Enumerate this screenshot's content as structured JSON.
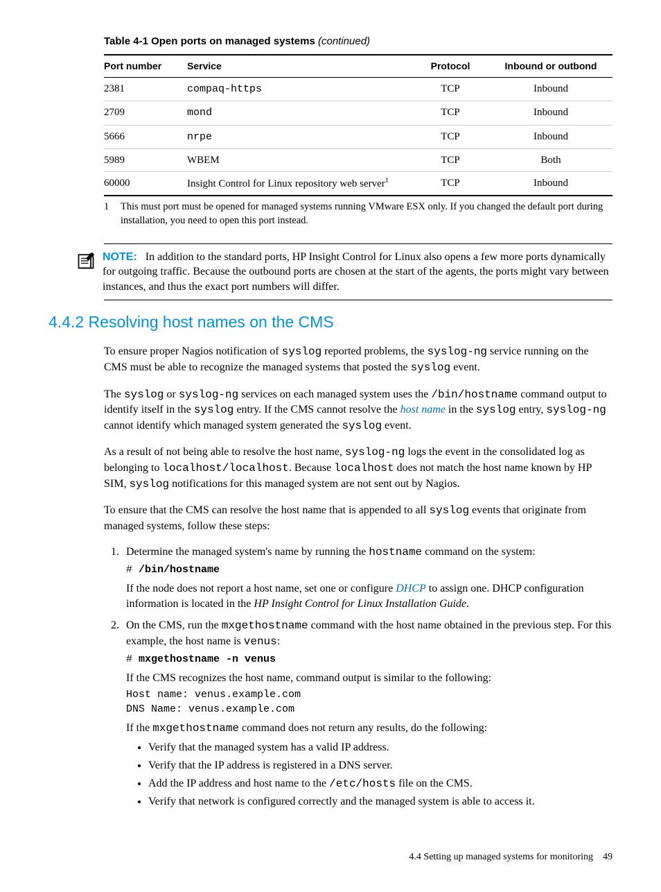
{
  "table": {
    "title_prefix": "Table 4-1 Open ports on managed systems ",
    "title_suffix": "(continued)",
    "headers": [
      "Port number",
      "Service",
      "Protocol",
      "Inbound or outbond"
    ],
    "rows": [
      {
        "port": "2381",
        "service": "compaq-https",
        "service_mono": true,
        "protocol": "TCP",
        "io": "Inbound"
      },
      {
        "port": "2709",
        "service": "mond",
        "service_mono": true,
        "protocol": "TCP",
        "io": "Inbound"
      },
      {
        "port": "5666",
        "service": "nrpe",
        "service_mono": true,
        "protocol": "TCP",
        "io": "Inbound"
      },
      {
        "port": "5989",
        "service": "WBEM",
        "service_mono": false,
        "protocol": "TCP",
        "io": "Both"
      },
      {
        "port": "60000",
        "service": "Insight Control for Linux repository web server",
        "service_mono": false,
        "sup": "1",
        "protocol": "TCP",
        "io": "Inbound"
      }
    ],
    "footnote_num": "1",
    "footnote_text": "This must port must be opened for managed systems running VMware ESX only. If you changed the default port during installation, you need to open this port instead."
  },
  "note": {
    "label": "NOTE:",
    "text": "In addition to the standard ports, HP Insight Control for Linux also opens a few more ports dynamically for outgoing traffic. Because the outbound ports are chosen at the start of the agents, the ports might vary between instances, and thus the exact port numbers will differ."
  },
  "section": {
    "number": "4.4.2",
    "title": "Resolving host names on the CMS"
  },
  "para1": {
    "t1": "To ensure proper Nagios notification of ",
    "c1": "syslog",
    "t2": " reported problems, the ",
    "c2": "syslog-ng",
    "t3": " service running on the CMS must be able to recognize the managed systems that posted the ",
    "c3": "syslog",
    "t4": " event."
  },
  "para2": {
    "t1": "The ",
    "c1": "syslog",
    "t2": " or ",
    "c2": "syslog-ng",
    "t3": " services on each managed system uses the ",
    "c3": "/bin/hostname",
    "t4": " command output to identify itself in the ",
    "c4": "syslog",
    "t5": " entry. If the CMS cannot resolve the ",
    "link": "host name",
    "t6": " in the ",
    "c5": "syslog",
    "t7": " entry, ",
    "c6": "syslog-ng",
    "t8": " cannot identify which managed system generated the ",
    "c7": "syslog",
    "t9": " event."
  },
  "para3": {
    "t1": "As a result of not being able to resolve the host name, ",
    "c1": "syslog-ng",
    "t2": " logs the event in the consolidated log as belonging to ",
    "c2": "localhost/localhost",
    "t3": ". Because ",
    "c3": "localhost",
    "t4": " does not match the host name known by HP SIM, ",
    "c4": "syslog",
    "t5": " notifications for this managed system are not sent out by Nagios."
  },
  "para4": {
    "t1": "To ensure that the CMS can resolve the host name that is appended to all ",
    "c1": "syslog",
    "t2": " events that originate from managed systems, follow these steps:"
  },
  "step1": {
    "intro_t1": "Determine the managed system's name by running the ",
    "intro_c1": "hostname",
    "intro_t2": " command on the system:",
    "cmd_prompt": "# ",
    "cmd": "/bin/hostname",
    "after_t1": "If the node does not report a host name, set one or configure ",
    "after_link": "DHCP",
    "after_t2": " to assign one. DHCP configuration information is located in the ",
    "after_i": "HP Insight Control for Linux Installation Guide",
    "after_t3": "."
  },
  "step2": {
    "intro_t1": "On the CMS, run the ",
    "intro_c1": "mxgethostname",
    "intro_t2": " command with the host name obtained in the previous step. For this example, the host name is ",
    "intro_c2": "venus",
    "intro_t3": ":",
    "cmd_prompt": "# ",
    "cmd": "mxgethostname -n venus",
    "recog": "If the CMS recognizes the host name, command output is similar to the following:",
    "output": "Host name: venus.example.com\nDNS Name: venus.example.com",
    "noresult_t1": "If the ",
    "noresult_c1": "mxgethostname",
    "noresult_t2": " command does not return any results, do the following:",
    "bullets": {
      "b1": "Verify that the managed system has a valid IP address.",
      "b2": "Verify that the IP address is registered in a DNS server.",
      "b3_t1": "Add the IP address and host name to the ",
      "b3_c1": "/etc/hosts",
      "b3_t2": " file on the CMS.",
      "b4": "Verify that network is configured correctly and the managed system is able to access it."
    }
  },
  "footer": {
    "section": "4.4 Setting up managed systems for monitoring",
    "page": "49"
  }
}
